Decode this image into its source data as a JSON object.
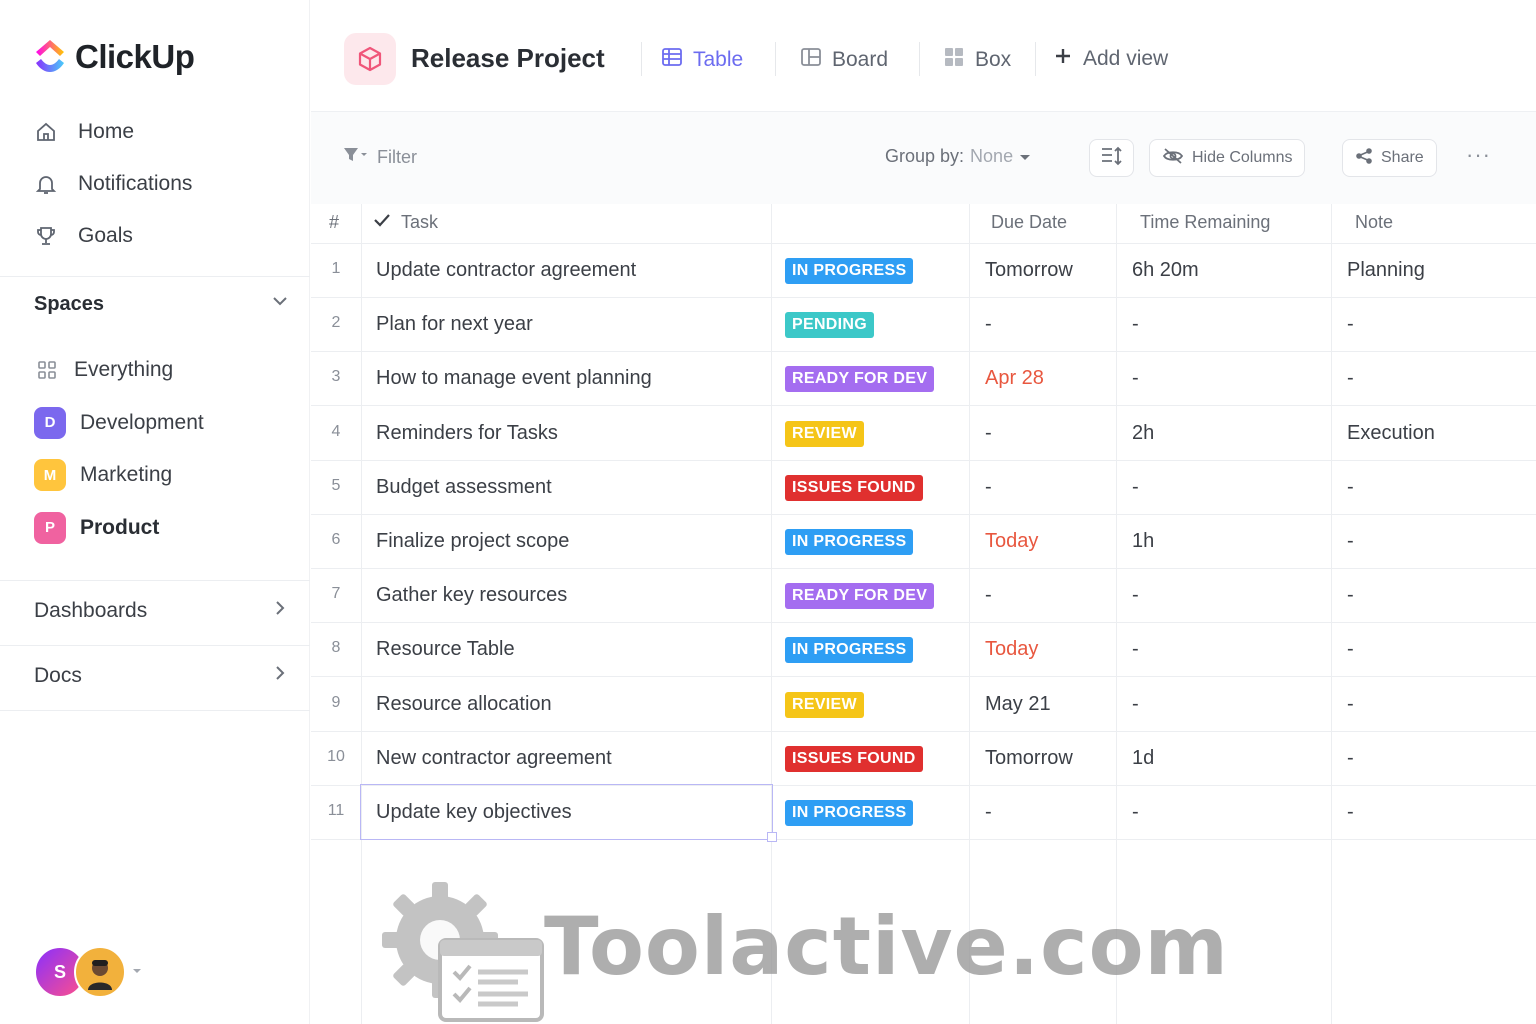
{
  "app": {
    "name": "ClickUp"
  },
  "sidebar": {
    "nav": [
      {
        "label": "Home",
        "icon": "home-icon"
      },
      {
        "label": "Notifications",
        "icon": "bell-icon"
      },
      {
        "label": "Goals",
        "icon": "trophy-icon"
      }
    ],
    "spaces_label": "Spaces",
    "spaces": [
      {
        "label": "Everything",
        "icon": "grid-icon"
      },
      {
        "label": "Development",
        "badge": "D",
        "color": "#7b68ee"
      },
      {
        "label": "Marketing",
        "badge": "M",
        "color": "#ffc53d"
      },
      {
        "label": "Product",
        "badge": "P",
        "color": "#f062a0"
      }
    ],
    "dashboards_label": "Dashboards",
    "docs_label": "Docs",
    "avatar_initial": "S"
  },
  "header": {
    "project_title": "Release Project",
    "views": [
      {
        "label": "Table",
        "icon": "table-icon",
        "active": true
      },
      {
        "label": "Board",
        "icon": "board-icon"
      },
      {
        "label": "Box",
        "icon": "box-icon"
      }
    ],
    "add_view": "Add view"
  },
  "toolbar": {
    "filter": "Filter",
    "group_by_label": "Group by:",
    "group_by_value": "None",
    "hide_columns": "Hide Columns",
    "share": "Share",
    "more": "···"
  },
  "table": {
    "headers": {
      "num": "#",
      "task": "Task",
      "due": "Due Date",
      "time": "Time Remaining",
      "note": "Note"
    },
    "status_colors": {
      "IN PROGRESS": "#2e9ef4",
      "PENDING": "#3cc8c8",
      "READY FOR DEV": "#a46df0",
      "REVIEW": "#f5c518",
      "ISSUES FOUND": "#e0302f"
    },
    "rows": [
      {
        "num": "1",
        "task": "Update contractor agreement",
        "status": "IN PROGRESS",
        "due": "Tomorrow",
        "due_red": false,
        "time": "6h 20m",
        "note": "Planning"
      },
      {
        "num": "2",
        "task": "Plan for next year",
        "status": "PENDING",
        "due": "-",
        "due_red": false,
        "time": "-",
        "note": "-"
      },
      {
        "num": "3",
        "task": "How to manage event planning",
        "status": "READY FOR DEV",
        "due": "Apr 28",
        "due_red": true,
        "time": "-",
        "note": "-"
      },
      {
        "num": "4",
        "task": "Reminders for Tasks",
        "status": "REVIEW",
        "due": "-",
        "due_red": false,
        "time": "2h",
        "note": "Execution"
      },
      {
        "num": "5",
        "task": "Budget assessment",
        "status": "ISSUES FOUND",
        "due": "-",
        "due_red": false,
        "time": "-",
        "note": "-"
      },
      {
        "num": "6",
        "task": "Finalize project scope",
        "status": "IN PROGRESS",
        "due": "Today",
        "due_red": true,
        "time": "1h",
        "note": "-"
      },
      {
        "num": "7",
        "task": "Gather key resources",
        "status": "READY FOR DEV",
        "due": "-",
        "due_red": false,
        "time": "-",
        "note": "-"
      },
      {
        "num": "8",
        "task": "Resource Table",
        "status": "IN PROGRESS",
        "due": "Today",
        "due_red": true,
        "time": "-",
        "note": "-"
      },
      {
        "num": "9",
        "task": "Resource allocation",
        "status": "REVIEW",
        "due": "May 21",
        "due_red": false,
        "time": "-",
        "note": "-"
      },
      {
        "num": "10",
        "task": "New contractor agreement",
        "status": "ISSUES FOUND",
        "due": "Tomorrow",
        "due_red": false,
        "time": "1d",
        "note": "-"
      },
      {
        "num": "11",
        "task": "Update key objectives",
        "status": "IN PROGRESS",
        "due": "-",
        "due_red": false,
        "time": "-",
        "note": "-",
        "selected": true
      }
    ]
  },
  "watermark": {
    "text": "Toolactive.com"
  }
}
